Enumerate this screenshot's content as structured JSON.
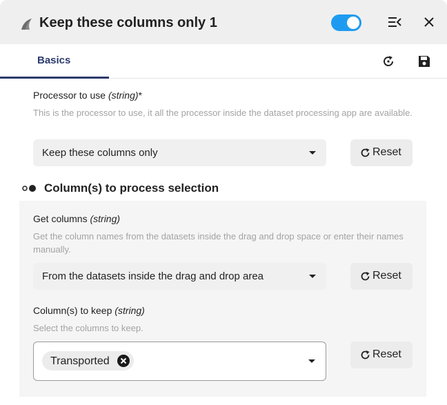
{
  "window": {
    "title": "Keep these columns only 1",
    "toggle_on": true,
    "accent_color": "#1e9bf0"
  },
  "tabs": [
    {
      "label": "Basics",
      "active": true
    }
  ],
  "processor": {
    "label": "Processor to use",
    "type": "(string)",
    "required_mark": "*",
    "description": "This is the processor to use, it all the processor inside the dataset processing app are available.",
    "value": "Keep these columns only",
    "reset_label": "Reset"
  },
  "section": {
    "title": "Column(s) to process selection"
  },
  "get_columns": {
    "label": "Get columns",
    "type": "(string)",
    "description": "Get the column names from the datasets inside the drag and drop space or enter their names manually.",
    "value": "From the datasets inside the drag and drop area",
    "reset_label": "Reset"
  },
  "columns_to_keep": {
    "label": "Column(s) to keep",
    "type": "(string)",
    "description": "Select the columns to keep.",
    "selected": [
      "Transported"
    ],
    "reset_label": "Reset"
  },
  "icons": {
    "app": "shark-fin-icon",
    "collapse": "collapse-panel-icon",
    "close": "close-icon",
    "refresh": "refresh-icon",
    "save": "save-icon",
    "reset": "reset-icon",
    "section": "section-dots-icon"
  }
}
